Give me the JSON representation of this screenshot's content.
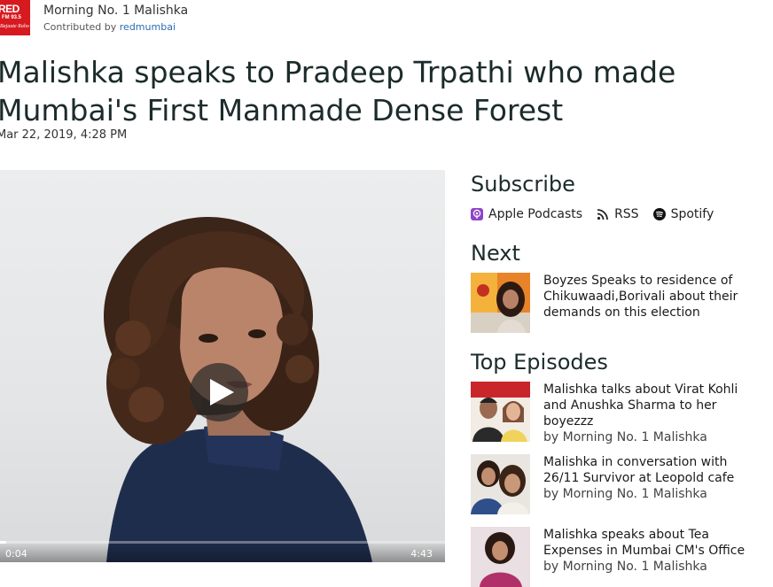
{
  "header": {
    "logo_line1": "RED",
    "logo_line2": "FM 93.5",
    "logo_line3": "Bajaate Raho",
    "show_title": "Morning No. 1 Malishka",
    "contributed_prefix": "Contributed by",
    "contributor": "redmumbai"
  },
  "episode": {
    "title": "Malishka speaks to Pradeep Trpathi who made\nMumbai's First Manmade Dense Forest",
    "date": "Mar 22, 2019, 4:28 PM"
  },
  "player": {
    "current_time": "0:04",
    "duration": "4:43",
    "progress": 0.014
  },
  "subscribe": {
    "heading": "Subscribe",
    "options": [
      {
        "label": "Apple Podcasts",
        "icon": "apple-podcasts-icon"
      },
      {
        "label": "RSS",
        "icon": "rss-icon"
      },
      {
        "label": "Spotify",
        "icon": "spotify-icon"
      }
    ]
  },
  "next": {
    "heading": "Next",
    "title": "Boyzes Speaks to residence of Chikuwaadi,Borivali about their demands on this election"
  },
  "top_episodes": {
    "heading": "Top Episodes",
    "items": [
      {
        "title": "Malishka talks about Virat Kohli and Anushka Sharma to her boyezzz",
        "by": "by Morning No. 1 Malishka"
      },
      {
        "title": "Malishka in conversation with 26/11 Survivor at Leopold cafe",
        "by": "by Morning No. 1 Malishka"
      },
      {
        "title": "Malishka speaks about Tea Expenses in Mumbai CM's Office",
        "by": "by Morning No. 1 Malishka"
      }
    ]
  },
  "colors": {
    "brand_red": "#d71920",
    "link_blue": "#2b6cb0",
    "heading": "#1c2b2b"
  }
}
